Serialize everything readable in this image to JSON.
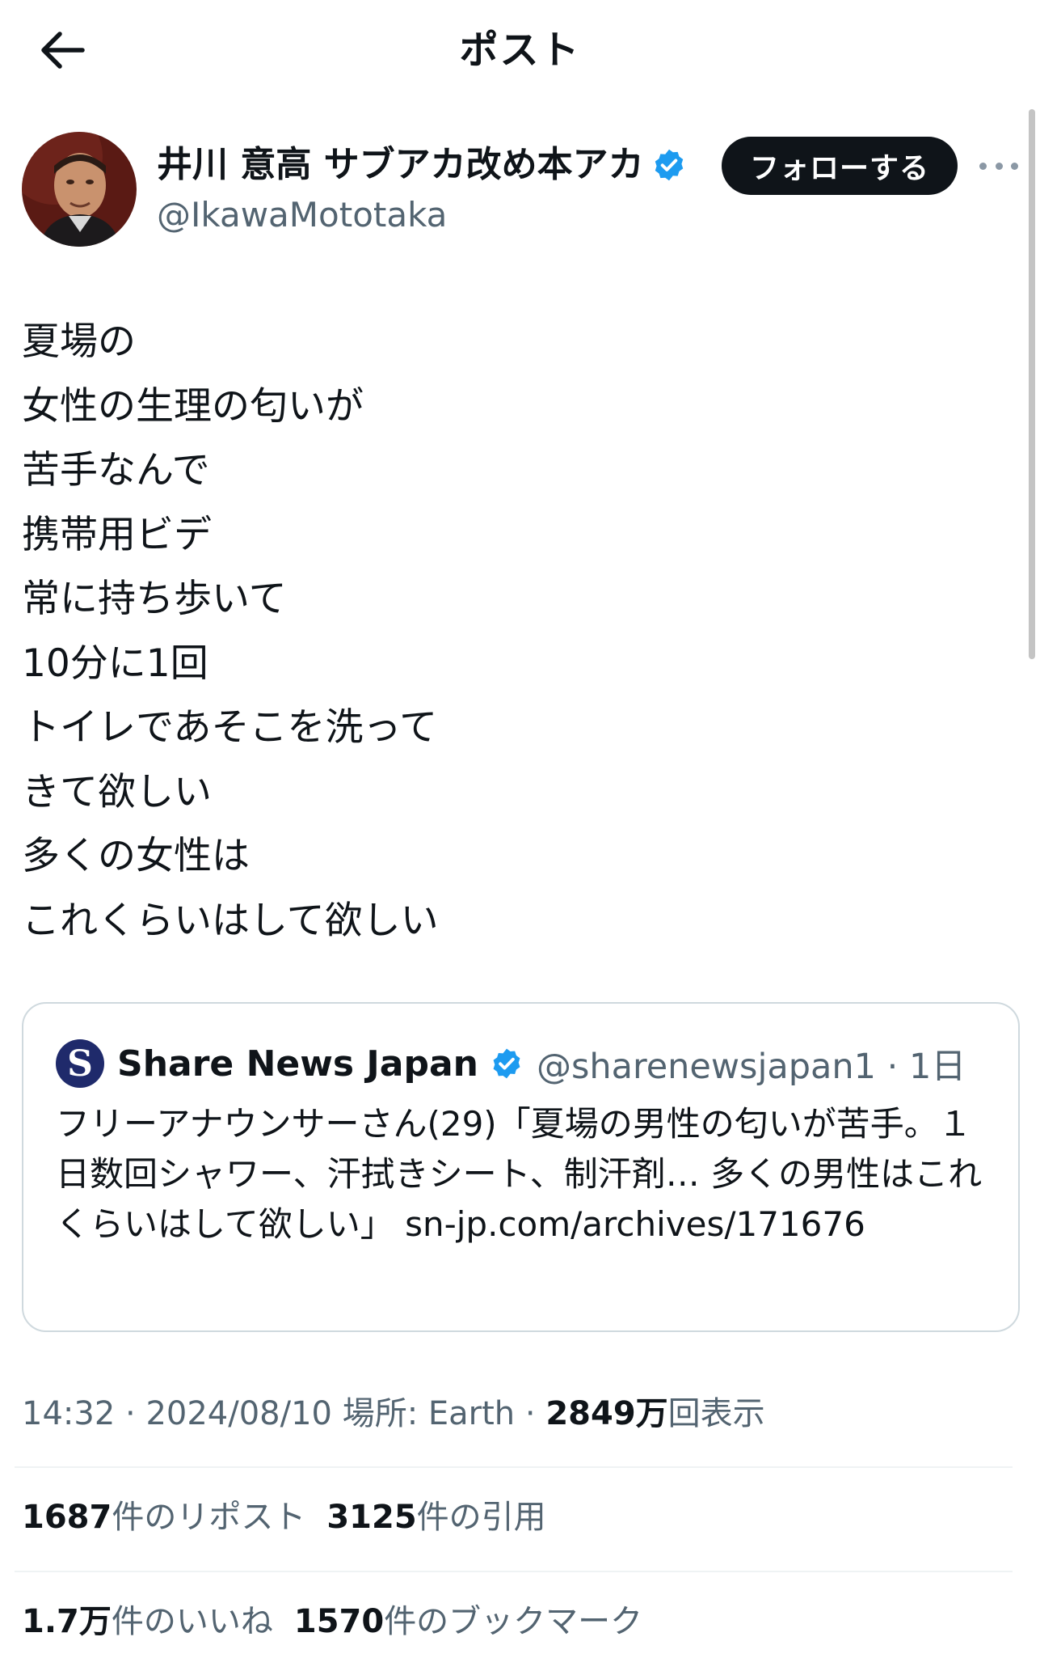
{
  "header": {
    "title": "ポスト",
    "back_icon": "arrow-left-icon"
  },
  "author": {
    "name": "井川 意高 サブアカ改め本アカ",
    "handle": "@IkawaMototaka",
    "verified": true,
    "follow_label": "フォローする"
  },
  "post": {
    "lines": [
      "夏場の",
      "女性の生理の匂いが",
      "苦手なんで",
      "携帯用ビデ",
      "常に持ち歩いて",
      "10分に1回",
      "トイレであそこを洗って",
      "きて欲しい",
      "多くの女性は",
      "これくらいはして欲しい"
    ]
  },
  "quote": {
    "logo_letter": "S",
    "name": "Share News Japan",
    "verified": true,
    "handle_time": "@sharenewsjapan1 · 1日",
    "text": "フリーアナウンサーさん(29)「夏場の男性の匂いが苦手。１日数回シャワー、汗拭きシート、制汗剤… 多くの男性はこれくらいはして欲しい」 ",
    "link": "sn-jp.com/archives/171676"
  },
  "meta": {
    "time": "14:32",
    "date": "2024/08/10",
    "location": "場所: Earth",
    "views_count": "2849万",
    "views_label": "回表示",
    "separator": "·"
  },
  "stats": {
    "reposts_count": "1687",
    "reposts_label": "件のリポスト",
    "quotes_count": "3125",
    "quotes_label": "件の引用",
    "likes_count": "1.7万",
    "likes_label": "件のいいね",
    "bookmarks_count": "1570",
    "bookmarks_label": "件のブックマーク"
  },
  "colors": {
    "text": "#0f1419",
    "secondary": "#536471",
    "verified": "#1d9bf0",
    "border": "#cfd9de",
    "follow_bg": "#0f1419"
  }
}
